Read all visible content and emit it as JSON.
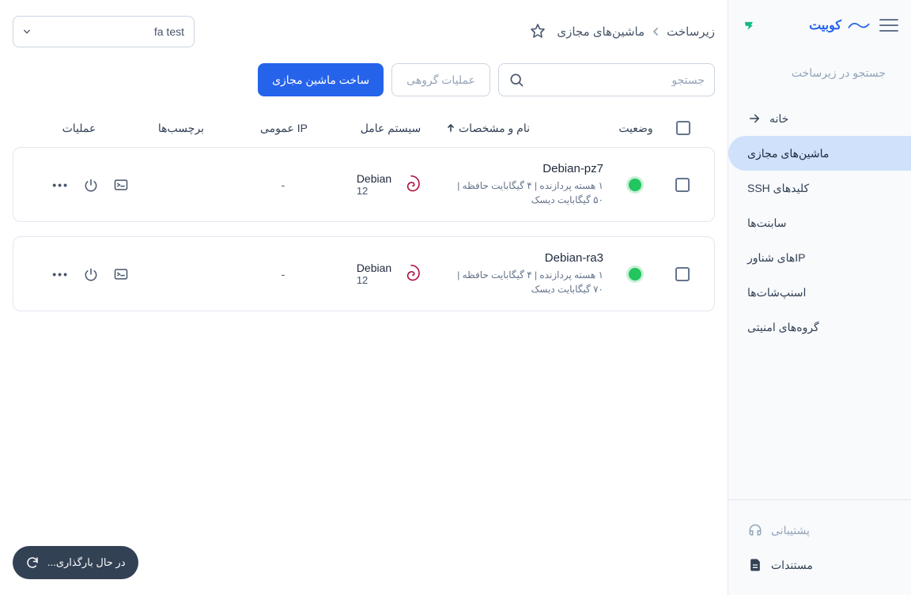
{
  "brand": {
    "name": "کوبیت"
  },
  "sidebar": {
    "search_placeholder": "جستجو در زیرساخت",
    "home_label": "خانه",
    "items": [
      {
        "label": "ماشین‌های مجازی",
        "active": true
      },
      {
        "label": "کلیدهای SSH"
      },
      {
        "label": "سابنت‌ها"
      },
      {
        "label": "IPهای شناور"
      },
      {
        "label": "اسنپ‌شات‌ها"
      },
      {
        "label": "گروه‌های امنیتی"
      }
    ],
    "footer": {
      "support": "پشتیبانی",
      "docs": "مستندات"
    }
  },
  "breadcrumb": {
    "root": "زیرساخت",
    "current": "ماشین‌های مجازی"
  },
  "project_selector": {
    "selected": "fa test"
  },
  "toolbar": {
    "search_placeholder": "جستجو",
    "group_ops": "عملیات گروهی",
    "create_vm": "ساخت ماشین مجازی"
  },
  "table": {
    "headers": {
      "status": "وضعیت",
      "name": "نام و مشخصات",
      "os": "سیستم عامل",
      "public_ip": "IP عمومی",
      "tags": "برچسب‌ها",
      "actions": "عملیات"
    },
    "rows": [
      {
        "name": "Debian-pz7",
        "specs": "۱ هسته پردازنده | ۴ گیگابایت حافظه | ۵۰ گیگابایت دیسک",
        "os_name": "Debian",
        "os_version": "12",
        "public_ip": "-"
      },
      {
        "name": "Debian-ra3",
        "specs": "۱ هسته پردازنده | ۴ گیگابایت حافظه | ۷۰ گیگابایت دیسک",
        "os_name": "Debian",
        "os_version": "12",
        "public_ip": "-"
      }
    ]
  },
  "loading": {
    "text": "در حال بارگذاری..."
  }
}
